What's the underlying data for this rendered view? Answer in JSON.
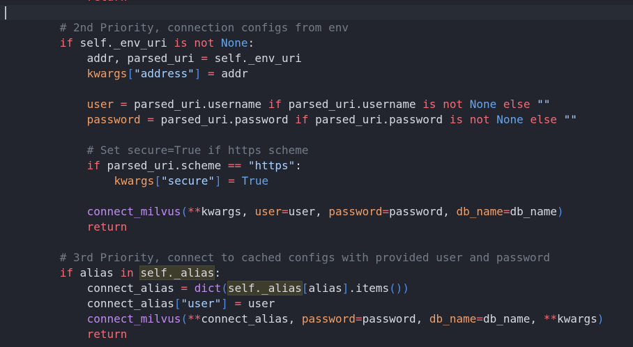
{
  "editor": {
    "lines": [
      {
        "indent": 12,
        "tokens": [
          {
            "t": "return",
            "c": "kw"
          }
        ]
      },
      {
        "indent": 0,
        "tokens": []
      },
      {
        "indent": 8,
        "tokens": [
          {
            "t": "# 2nd Priority, connection configs from env",
            "c": "cm"
          }
        ]
      },
      {
        "indent": 8,
        "tokens": [
          {
            "t": "if",
            "c": "kw"
          },
          {
            "t": " self._env_uri ",
            "c": "nm"
          },
          {
            "t": "is",
            "c": "kw"
          },
          {
            "t": " ",
            "c": "nm"
          },
          {
            "t": "not",
            "c": "kw"
          },
          {
            "t": " ",
            "c": "nm"
          },
          {
            "t": "None",
            "c": "const"
          },
          {
            "t": ":",
            "c": "nm"
          }
        ]
      },
      {
        "indent": 12,
        "tokens": [
          {
            "t": "addr, parsed_uri ",
            "c": "nm"
          },
          {
            "t": "=",
            "c": "op"
          },
          {
            "t": " self._env_uri",
            "c": "nm"
          }
        ]
      },
      {
        "indent": 12,
        "tokens": [
          {
            "t": "kwargs",
            "c": "var"
          },
          {
            "t": "[",
            "c": "br"
          },
          {
            "t": "\"address\"",
            "c": "str"
          },
          {
            "t": "]",
            "c": "br"
          },
          {
            "t": " ",
            "c": "nm"
          },
          {
            "t": "=",
            "c": "op"
          },
          {
            "t": " addr",
            "c": "nm"
          }
        ]
      },
      {
        "indent": 0,
        "tokens": []
      },
      {
        "indent": 12,
        "tokens": [
          {
            "t": "user",
            "c": "var"
          },
          {
            "t": " ",
            "c": "nm"
          },
          {
            "t": "=",
            "c": "op"
          },
          {
            "t": " parsed_uri.username ",
            "c": "nm"
          },
          {
            "t": "if",
            "c": "kw"
          },
          {
            "t": " parsed_uri.username ",
            "c": "nm"
          },
          {
            "t": "is",
            "c": "kw"
          },
          {
            "t": " ",
            "c": "nm"
          },
          {
            "t": "not",
            "c": "kw"
          },
          {
            "t": " ",
            "c": "nm"
          },
          {
            "t": "None",
            "c": "const"
          },
          {
            "t": " ",
            "c": "nm"
          },
          {
            "t": "else",
            "c": "kw"
          },
          {
            "t": " ",
            "c": "nm"
          },
          {
            "t": "\"\"",
            "c": "str"
          }
        ]
      },
      {
        "indent": 12,
        "tokens": [
          {
            "t": "password",
            "c": "var"
          },
          {
            "t": " ",
            "c": "nm"
          },
          {
            "t": "=",
            "c": "op"
          },
          {
            "t": " parsed_uri.password ",
            "c": "nm"
          },
          {
            "t": "if",
            "c": "kw"
          },
          {
            "t": " parsed_uri.password ",
            "c": "nm"
          },
          {
            "t": "is",
            "c": "kw"
          },
          {
            "t": " ",
            "c": "nm"
          },
          {
            "t": "not",
            "c": "kw"
          },
          {
            "t": " ",
            "c": "nm"
          },
          {
            "t": "None",
            "c": "const"
          },
          {
            "t": " ",
            "c": "nm"
          },
          {
            "t": "else",
            "c": "kw"
          },
          {
            "t": " ",
            "c": "nm"
          },
          {
            "t": "\"\"",
            "c": "str"
          }
        ]
      },
      {
        "indent": 0,
        "tokens": []
      },
      {
        "indent": 12,
        "tokens": [
          {
            "t": "# Set secure=True if https scheme",
            "c": "cm"
          }
        ]
      },
      {
        "indent": 12,
        "tokens": [
          {
            "t": "if",
            "c": "kw"
          },
          {
            "t": " parsed_uri.scheme ",
            "c": "nm"
          },
          {
            "t": "==",
            "c": "op"
          },
          {
            "t": " ",
            "c": "nm"
          },
          {
            "t": "\"https\"",
            "c": "str"
          },
          {
            "t": ":",
            "c": "nm"
          }
        ]
      },
      {
        "indent": 16,
        "tokens": [
          {
            "t": "kwargs",
            "c": "var"
          },
          {
            "t": "[",
            "c": "br"
          },
          {
            "t": "\"secure\"",
            "c": "str"
          },
          {
            "t": "]",
            "c": "br"
          },
          {
            "t": " ",
            "c": "nm"
          },
          {
            "t": "=",
            "c": "op"
          },
          {
            "t": " ",
            "c": "nm"
          },
          {
            "t": "True",
            "c": "const"
          }
        ]
      },
      {
        "indent": 0,
        "tokens": []
      },
      {
        "indent": 12,
        "tokens": [
          {
            "t": "connect_milvus",
            "c": "fn"
          },
          {
            "t": "(",
            "c": "br"
          },
          {
            "t": "**",
            "c": "op"
          },
          {
            "t": "kwargs",
            "c": "nm"
          },
          {
            "t": ", ",
            "c": "nm"
          },
          {
            "t": "user",
            "c": "var"
          },
          {
            "t": "=",
            "c": "op"
          },
          {
            "t": "user, ",
            "c": "nm"
          },
          {
            "t": "password",
            "c": "var"
          },
          {
            "t": "=",
            "c": "op"
          },
          {
            "t": "password, ",
            "c": "nm"
          },
          {
            "t": "db_name",
            "c": "var"
          },
          {
            "t": "=",
            "c": "op"
          },
          {
            "t": "db_name",
            "c": "nm"
          },
          {
            "t": ")",
            "c": "br"
          }
        ]
      },
      {
        "indent": 12,
        "tokens": [
          {
            "t": "return",
            "c": "kw"
          }
        ]
      },
      {
        "indent": 0,
        "tokens": []
      },
      {
        "indent": 8,
        "tokens": [
          {
            "t": "# 3rd Priority, connect to cached configs with provided user and password",
            "c": "cm"
          }
        ]
      },
      {
        "indent": 8,
        "tokens": [
          {
            "t": "if",
            "c": "kw"
          },
          {
            "t": " alias ",
            "c": "nm"
          },
          {
            "t": "in",
            "c": "kw"
          },
          {
            "t": " ",
            "c": "nm"
          },
          {
            "t": "self._alias",
            "c": "nm",
            "hl": true
          },
          {
            "t": ":",
            "c": "nm"
          }
        ]
      },
      {
        "indent": 12,
        "tokens": [
          {
            "t": "connect_alias ",
            "c": "nm"
          },
          {
            "t": "=",
            "c": "op"
          },
          {
            "t": " ",
            "c": "nm"
          },
          {
            "t": "dict",
            "c": "fn"
          },
          {
            "t": "(",
            "c": "br"
          },
          {
            "t": "self._alias",
            "c": "nm",
            "hl": true
          },
          {
            "t": "[",
            "c": "br"
          },
          {
            "t": "alias",
            "c": "nm"
          },
          {
            "t": "]",
            "c": "br"
          },
          {
            "t": ".items",
            "c": "nm"
          },
          {
            "t": "()",
            "c": "br"
          },
          {
            "t": ")",
            "c": "br"
          }
        ]
      },
      {
        "indent": 12,
        "tokens": [
          {
            "t": "connect_alias",
            "c": "nm"
          },
          {
            "t": "[",
            "c": "br"
          },
          {
            "t": "\"user\"",
            "c": "str"
          },
          {
            "t": "]",
            "c": "br"
          },
          {
            "t": " ",
            "c": "nm"
          },
          {
            "t": "=",
            "c": "op"
          },
          {
            "t": " user",
            "c": "nm"
          }
        ]
      },
      {
        "indent": 12,
        "tokens": [
          {
            "t": "connect_milvus",
            "c": "fn"
          },
          {
            "t": "(",
            "c": "br"
          },
          {
            "t": "**",
            "c": "op"
          },
          {
            "t": "connect_alias, ",
            "c": "nm"
          },
          {
            "t": "password",
            "c": "var"
          },
          {
            "t": "=",
            "c": "op"
          },
          {
            "t": "password, ",
            "c": "nm"
          },
          {
            "t": "db_name",
            "c": "var"
          },
          {
            "t": "=",
            "c": "op"
          },
          {
            "t": "db_name, ",
            "c": "nm"
          },
          {
            "t": "**",
            "c": "op"
          },
          {
            "t": "kwargs",
            "c": "nm"
          },
          {
            "t": ")",
            "c": "br"
          }
        ]
      },
      {
        "indent": 12,
        "tokens": [
          {
            "t": "return",
            "c": "kw"
          }
        ]
      }
    ]
  }
}
